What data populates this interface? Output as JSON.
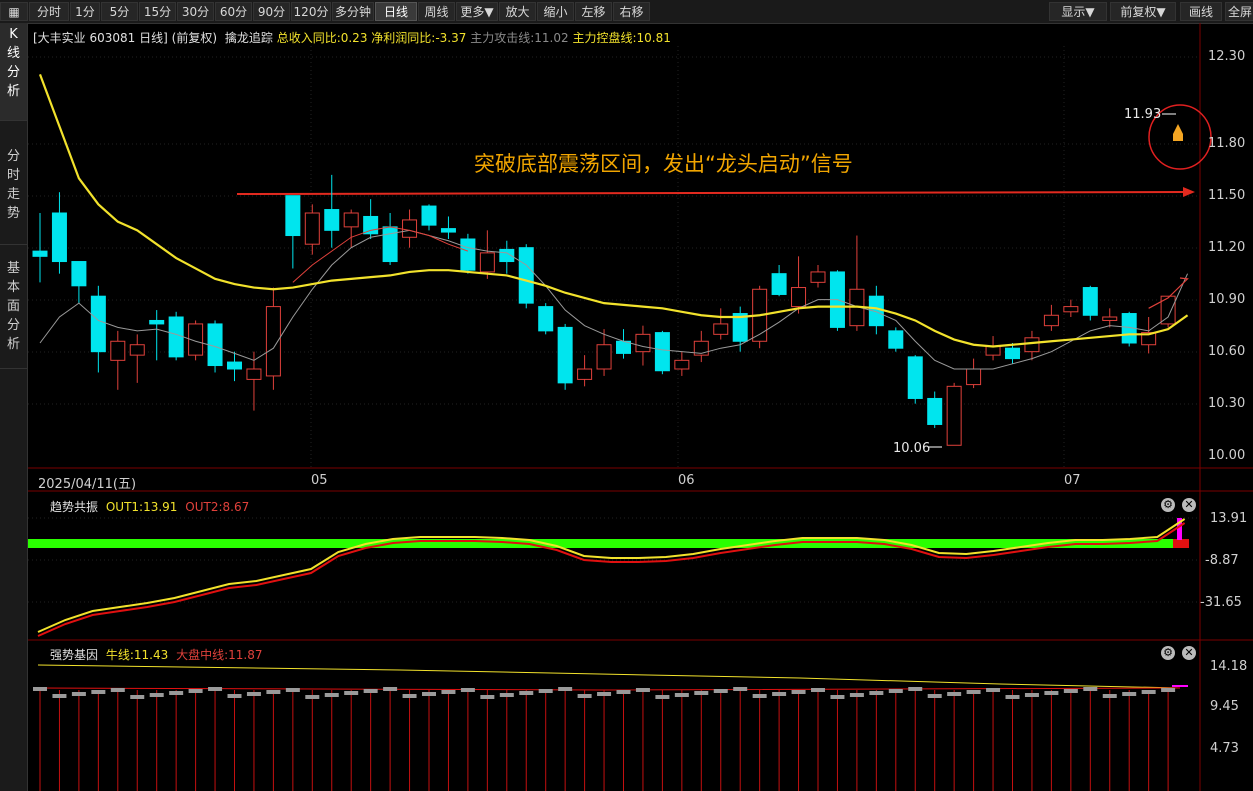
{
  "toolbar": {
    "items": [
      "分时",
      "1分",
      "5分",
      "15分",
      "30分",
      "60分",
      "90分",
      "120分",
      "多分钟",
      "日线",
      "周线",
      "更多▼",
      "放大",
      "缩小",
      "左移",
      "右移"
    ],
    "right_items": [
      "显示▼",
      "前复权▼",
      "画线",
      "全屏"
    ],
    "active": "日线"
  },
  "sidebar": {
    "tabs": [
      {
        "label": "K\n线\n分\n析"
      },
      {
        "label": "分\n时\n走\n势"
      },
      {
        "label": "基\n本\n面\n分\n析"
      }
    ]
  },
  "main_header": {
    "security": "[大丰实业 603081 日线]",
    "adjust": "(前复权)",
    "indicator_name": "擒龙追踪",
    "revenue": "总收入同比:0.23",
    "profit": "净利润同比:-3.37",
    "attack": "主力攻击线:11.02",
    "control": "主力控盘线:10.81"
  },
  "annotation": {
    "text": "突破底部震荡区间，发出“龙头启动”信号",
    "high_label": "11.93",
    "low_label": "10.06"
  },
  "price_axis": [
    "12.30",
    "11.80",
    "11.50",
    "11.20",
    "10.90",
    "10.60",
    "10.30",
    "10.00"
  ],
  "date_axis": [
    "2025/04/11(五)",
    "05",
    "06",
    "07"
  ],
  "sub1": {
    "name": "趋势共振",
    "out1": "OUT1:13.91",
    "out2": "OUT2:8.67",
    "axis": [
      "13.91",
      "-8.87",
      "-31.65"
    ]
  },
  "sub2": {
    "name": "强势基因",
    "bull": "牛线:11.43",
    "market": "大盘中线:11.87",
    "axis": [
      "14.18",
      "9.45",
      "4.73"
    ]
  },
  "colors": {
    "up": "#e0413b",
    "down": "#00e5ee",
    "ma_yellow": "#f2e22c",
    "ma_gray": "#9a9a9a",
    "arrow": "#e22a1f",
    "annotation": "#f1a500"
  },
  "chart_data": {
    "type": "candlestick",
    "ylim": [
      10.0,
      12.3
    ],
    "candles": [
      {
        "o": 11.18,
        "c": 11.15,
        "h": 11.4,
        "l": 11.0
      },
      {
        "o": 11.4,
        "c": 11.12,
        "h": 11.52,
        "l": 11.05
      },
      {
        "o": 11.12,
        "c": 10.98,
        "h": 11.12,
        "l": 10.88
      },
      {
        "o": 10.92,
        "c": 10.6,
        "h": 10.98,
        "l": 10.48
      },
      {
        "o": 10.55,
        "c": 10.66,
        "h": 10.72,
        "l": 10.38
      },
      {
        "o": 10.58,
        "c": 10.64,
        "h": 10.7,
        "l": 10.42
      },
      {
        "o": 10.78,
        "c": 10.76,
        "h": 10.84,
        "l": 10.55
      },
      {
        "o": 10.8,
        "c": 10.57,
        "h": 10.83,
        "l": 10.55
      },
      {
        "o": 10.58,
        "c": 10.76,
        "h": 10.78,
        "l": 10.55
      },
      {
        "o": 10.76,
        "c": 10.52,
        "h": 10.78,
        "l": 10.48
      },
      {
        "o": 10.54,
        "c": 10.5,
        "h": 10.6,
        "l": 10.43
      },
      {
        "o": 10.44,
        "c": 10.5,
        "h": 10.6,
        "l": 10.26
      },
      {
        "o": 10.46,
        "c": 10.86,
        "h": 10.97,
        "l": 10.38
      },
      {
        "o": 11.5,
        "c": 11.27,
        "h": 11.5,
        "l": 11.08
      },
      {
        "o": 11.22,
        "c": 11.4,
        "h": 11.45,
        "l": 11.16
      },
      {
        "o": 11.42,
        "c": 11.3,
        "h": 11.62,
        "l": 11.2
      },
      {
        "o": 11.32,
        "c": 11.4,
        "h": 11.42,
        "l": 11.2
      },
      {
        "o": 11.38,
        "c": 11.28,
        "h": 11.48,
        "l": 11.25
      },
      {
        "o": 11.32,
        "c": 11.12,
        "h": 11.4,
        "l": 11.1
      },
      {
        "o": 11.26,
        "c": 11.36,
        "h": 11.42,
        "l": 11.2
      },
      {
        "o": 11.44,
        "c": 11.33,
        "h": 11.45,
        "l": 11.3
      },
      {
        "o": 11.31,
        "c": 11.29,
        "h": 11.38,
        "l": 11.25
      },
      {
        "o": 11.25,
        "c": 11.07,
        "h": 11.28,
        "l": 11.05
      },
      {
        "o": 11.06,
        "c": 11.17,
        "h": 11.3,
        "l": 11.02
      },
      {
        "o": 11.19,
        "c": 11.12,
        "h": 11.24,
        "l": 11.05
      },
      {
        "o": 11.2,
        "c": 10.88,
        "h": 11.22,
        "l": 10.85
      },
      {
        "o": 10.86,
        "c": 10.72,
        "h": 10.88,
        "l": 10.7
      },
      {
        "o": 10.74,
        "c": 10.42,
        "h": 10.76,
        "l": 10.38
      },
      {
        "o": 10.44,
        "c": 10.5,
        "h": 10.58,
        "l": 10.4
      },
      {
        "o": 10.5,
        "c": 10.64,
        "h": 10.73,
        "l": 10.46
      },
      {
        "o": 10.66,
        "c": 10.59,
        "h": 10.73,
        "l": 10.56
      },
      {
        "o": 10.6,
        "c": 10.7,
        "h": 10.75,
        "l": 10.52
      },
      {
        "o": 10.71,
        "c": 10.49,
        "h": 10.72,
        "l": 10.47
      },
      {
        "o": 10.5,
        "c": 10.55,
        "h": 10.6,
        "l": 10.46
      },
      {
        "o": 10.58,
        "c": 10.66,
        "h": 10.72,
        "l": 10.54
      },
      {
        "o": 10.7,
        "c": 10.76,
        "h": 10.85,
        "l": 10.67
      },
      {
        "o": 10.82,
        "c": 10.66,
        "h": 10.86,
        "l": 10.6
      },
      {
        "o": 10.66,
        "c": 10.96,
        "h": 10.98,
        "l": 10.62
      },
      {
        "o": 11.05,
        "c": 10.93,
        "h": 11.1,
        "l": 10.92
      },
      {
        "o": 10.86,
        "c": 10.97,
        "h": 11.15,
        "l": 10.82
      },
      {
        "o": 11.0,
        "c": 11.06,
        "h": 11.1,
        "l": 10.97
      },
      {
        "o": 11.06,
        "c": 10.74,
        "h": 11.07,
        "l": 10.72
      },
      {
        "o": 10.75,
        "c": 10.96,
        "h": 11.27,
        "l": 10.72
      },
      {
        "o": 10.92,
        "c": 10.75,
        "h": 10.98,
        "l": 10.7
      },
      {
        "o": 10.72,
        "c": 10.62,
        "h": 10.74,
        "l": 10.6
      },
      {
        "o": 10.57,
        "c": 10.33,
        "h": 10.58,
        "l": 10.3
      },
      {
        "o": 10.33,
        "c": 10.18,
        "h": 10.37,
        "l": 10.16
      },
      {
        "o": 10.06,
        "c": 10.4,
        "h": 10.42,
        "l": 10.06
      },
      {
        "o": 10.41,
        "c": 10.5,
        "h": 10.56,
        "l": 10.39
      },
      {
        "o": 10.58,
        "c": 10.63,
        "h": 10.69,
        "l": 10.55
      },
      {
        "o": 10.62,
        "c": 10.56,
        "h": 10.65,
        "l": 10.53
      },
      {
        "o": 10.6,
        "c": 10.68,
        "h": 10.72,
        "l": 10.55
      },
      {
        "o": 10.75,
        "c": 10.81,
        "h": 10.87,
        "l": 10.72
      },
      {
        "o": 10.83,
        "c": 10.86,
        "h": 10.9,
        "l": 10.8
      },
      {
        "o": 10.97,
        "c": 10.81,
        "h": 10.98,
        "l": 10.78
      },
      {
        "o": 10.78,
        "c": 10.8,
        "h": 10.85,
        "l": 10.74
      },
      {
        "o": 10.82,
        "c": 10.65,
        "h": 10.83,
        "l": 10.63
      },
      {
        "o": 10.64,
        "c": 10.71,
        "h": 10.8,
        "l": 10.59
      },
      {
        "o": 10.76,
        "c": 10.92,
        "h": 10.92,
        "l": 10.74
      }
    ],
    "ma_yellow": [
      12.2,
      11.9,
      11.6,
      11.45,
      11.35,
      11.3,
      11.22,
      11.14,
      11.08,
      11.02,
      10.99,
      10.97,
      10.96,
      10.97,
      10.99,
      11.01,
      11.02,
      11.03,
      11.04,
      11.06,
      11.07,
      11.07,
      11.06,
      11.05,
      11.04,
      11.01,
      10.98,
      10.94,
      10.91,
      10.88,
      10.87,
      10.86,
      10.85,
      10.83,
      10.81,
      10.8,
      10.8,
      10.81,
      10.83,
      10.85,
      10.86,
      10.86,
      10.86,
      10.85,
      10.82,
      10.78,
      10.72,
      10.67,
      10.64,
      10.63,
      10.64,
      10.65,
      10.66,
      10.67,
      10.68,
      10.69,
      10.7,
      10.7,
      10.73,
      10.81
    ],
    "ma_gray": [
      10.65,
      10.8,
      10.88,
      10.78,
      10.74,
      10.72,
      10.73,
      10.7,
      10.66,
      10.63,
      10.59,
      10.55,
      10.62,
      10.8,
      10.96,
      11.1,
      11.2,
      11.26,
      11.28,
      11.3,
      11.27,
      11.24,
      11.2,
      11.18,
      11.17,
      11.1,
      10.98,
      10.84,
      10.75,
      10.7,
      10.66,
      10.63,
      10.61,
      10.6,
      10.59,
      10.62,
      10.64,
      10.7,
      10.77,
      10.85,
      10.9,
      10.9,
      10.86,
      10.83,
      10.78,
      10.66,
      10.55,
      10.5,
      10.5,
      10.5,
      10.53,
      10.56,
      10.6,
      10.66,
      10.72,
      10.75,
      10.74,
      10.72,
      10.8,
      11.05
    ]
  }
}
